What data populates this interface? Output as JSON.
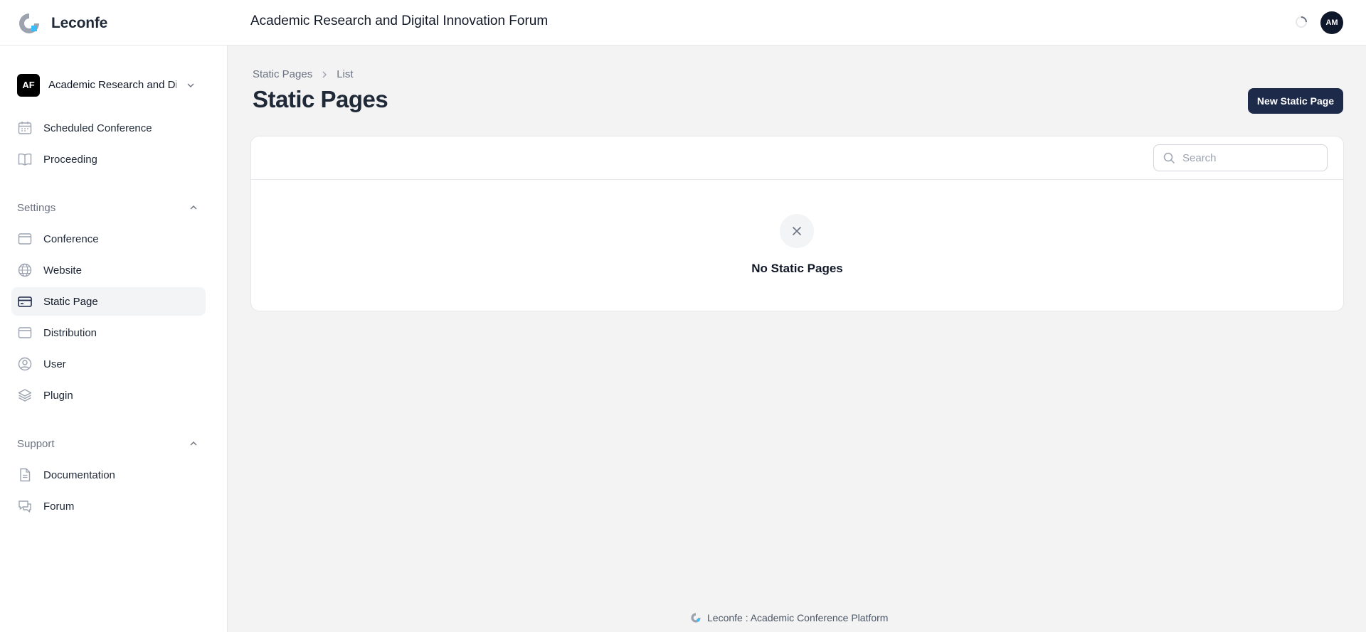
{
  "app": {
    "name": "Leconfe",
    "conference_title": "Academic Research and Digital Innovation Forum"
  },
  "user": {
    "initials": "AM"
  },
  "tenant": {
    "badge": "AF",
    "name": "Academic Research and Digital Innovation Forum"
  },
  "sidebar": {
    "top_items": [
      {
        "label": "Scheduled Conference",
        "icon": "calendar-icon"
      },
      {
        "label": "Proceeding",
        "icon": "book-icon"
      }
    ],
    "settings": {
      "label": "Settings",
      "items": [
        {
          "label": "Conference",
          "icon": "window-icon"
        },
        {
          "label": "Website",
          "icon": "globe-icon"
        },
        {
          "label": "Static Page",
          "icon": "credit-card-icon",
          "active": true
        },
        {
          "label": "Distribution",
          "icon": "window-icon"
        },
        {
          "label": "User",
          "icon": "user-circle-icon"
        },
        {
          "label": "Plugin",
          "icon": "layers-icon"
        }
      ]
    },
    "support": {
      "label": "Support",
      "items": [
        {
          "label": "Documentation",
          "icon": "document-icon"
        },
        {
          "label": "Forum",
          "icon": "chat-icon"
        }
      ]
    }
  },
  "breadcrumb": {
    "parent": "Static Pages",
    "current": "List"
  },
  "page": {
    "title": "Static Pages",
    "new_button": "New Static Page"
  },
  "table": {
    "search_placeholder": "Search",
    "empty_message": "No Static Pages"
  },
  "footer": {
    "text": "Leconfe : Academic Conference Platform"
  },
  "colors": {
    "primary": "#1e2a4a",
    "accent": "#38bdf8",
    "background": "#f3f3f4"
  }
}
